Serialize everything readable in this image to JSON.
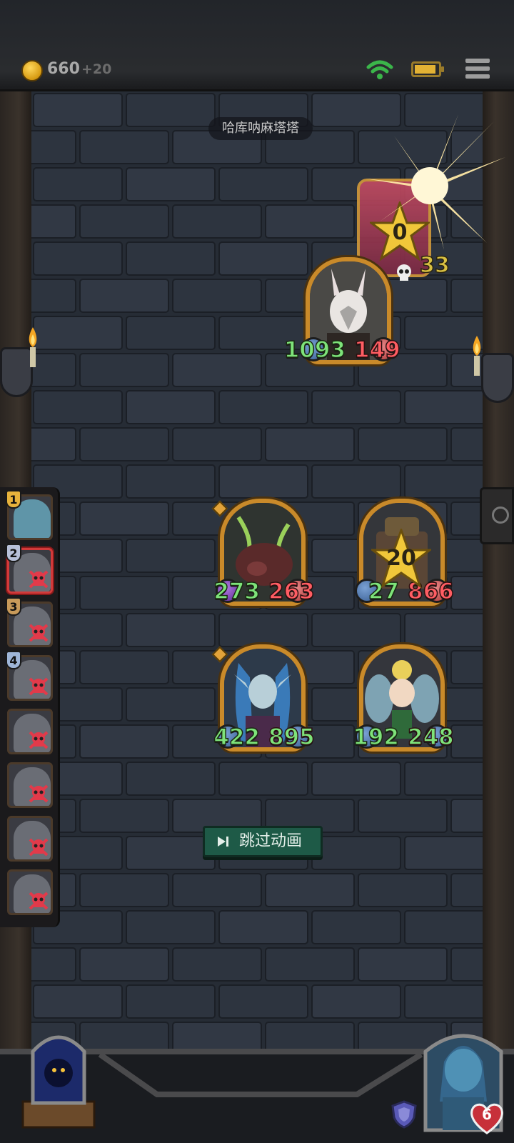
{
  "header": {
    "gold": "660",
    "gold_income": "+20",
    "battery_level": 0.85,
    "icons": [
      "coin-icon",
      "wifi-icon",
      "battery-icon",
      "menu-icon"
    ]
  },
  "board": {
    "opponent_name": "哈库呐麻塔塔",
    "skip_button": "跳过动画",
    "opponent_unit": {
      "atk": "1093",
      "hp": "149"
    },
    "attack_effect": {
      "star_value": "0",
      "skull_value": "33"
    },
    "player_units": [
      {
        "name": "boar",
        "atk": "273",
        "hp": "263"
      },
      {
        "name": "treasure",
        "atk": "27",
        "hp": "866",
        "star_value": "20"
      },
      {
        "name": "elf",
        "atk": "422",
        "hp": "895"
      },
      {
        "name": "fairy",
        "atk": "192",
        "hp": "248"
      }
    ]
  },
  "opponents_list": [
    {
      "rank": "1",
      "eliminated": false,
      "active": false,
      "badge_color": "#e6b23c"
    },
    {
      "rank": "2",
      "eliminated": true,
      "active": true,
      "badge_color": "#b7c0d8"
    },
    {
      "rank": "3",
      "eliminated": true,
      "active": false,
      "badge_color": "#c89a5a"
    },
    {
      "rank": "4",
      "eliminated": true,
      "active": false,
      "badge_color": "#9fb6d8"
    },
    {
      "rank": "",
      "eliminated": true,
      "active": false
    },
    {
      "rank": "",
      "eliminated": true,
      "active": false
    },
    {
      "rank": "",
      "eliminated": true,
      "active": false
    },
    {
      "rank": "",
      "eliminated": true,
      "active": false
    }
  ],
  "player": {
    "health": "6"
  },
  "colors": {
    "atk": "#7ee37a",
    "hp": "#ff5d63",
    "frame": "#c98a2a",
    "skip_bg": "#1e5a47"
  }
}
